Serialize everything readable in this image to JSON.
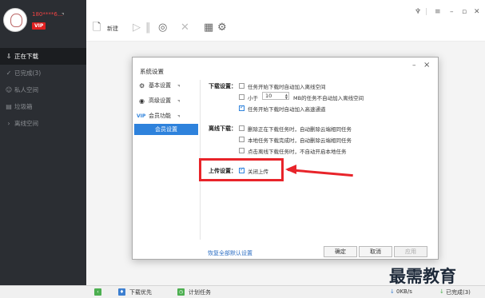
{
  "user": {
    "name": "180****6...",
    "vip": "VIP"
  },
  "sidebar": {
    "items": [
      {
        "label": "正在下载",
        "icon": "download-icon"
      },
      {
        "label": "已完成(3)",
        "icon": "check-circle-icon"
      },
      {
        "label": "私人空间",
        "icon": "person-icon"
      },
      {
        "label": "垃圾箱",
        "icon": "trash-icon"
      },
      {
        "label": "离线空间",
        "icon": "cloud-icon"
      }
    ]
  },
  "toolbar": {
    "new_label": "新建"
  },
  "dialog": {
    "title": "系统设置",
    "nav": [
      {
        "label": "基本设置"
      },
      {
        "label": "高级设置"
      },
      {
        "label": "会员功能",
        "prefix": "VIP"
      }
    ],
    "nav_sub": "会员设置",
    "download": {
      "label": "下载设置：",
      "opt1": "任务开始下载时自动加入离线空间",
      "opt2_prefix": "小于",
      "opt2_value": "10",
      "opt2_suffix": "MB的任务不自动加入离线空间",
      "opt3": "任务开始下载时自动加入高速通道"
    },
    "offline": {
      "label": "离线下载：",
      "opt1": "删除正在下载任务时，自动删除云端相同任务",
      "opt2": "本地任务下载完成时，自动删除云端相同任务",
      "opt3": "点击离线下载任务时，不自动开启本地任务"
    },
    "upload": {
      "label": "上传设置：",
      "opt1": "关闭上传"
    },
    "restore_link": "恢复全部默认设置",
    "buttons": {
      "ok": "确定",
      "cancel": "取消",
      "apply": "应用"
    }
  },
  "statusbar": {
    "download_first": "下载优先",
    "plan_task": "计划任务",
    "speed": "0KB/s",
    "done": "已完成(3)"
  },
  "watermark": "最需教育",
  "colors": {
    "accent": "#2e82dc",
    "annotation": "#e8242a",
    "vip": "#e02020"
  }
}
